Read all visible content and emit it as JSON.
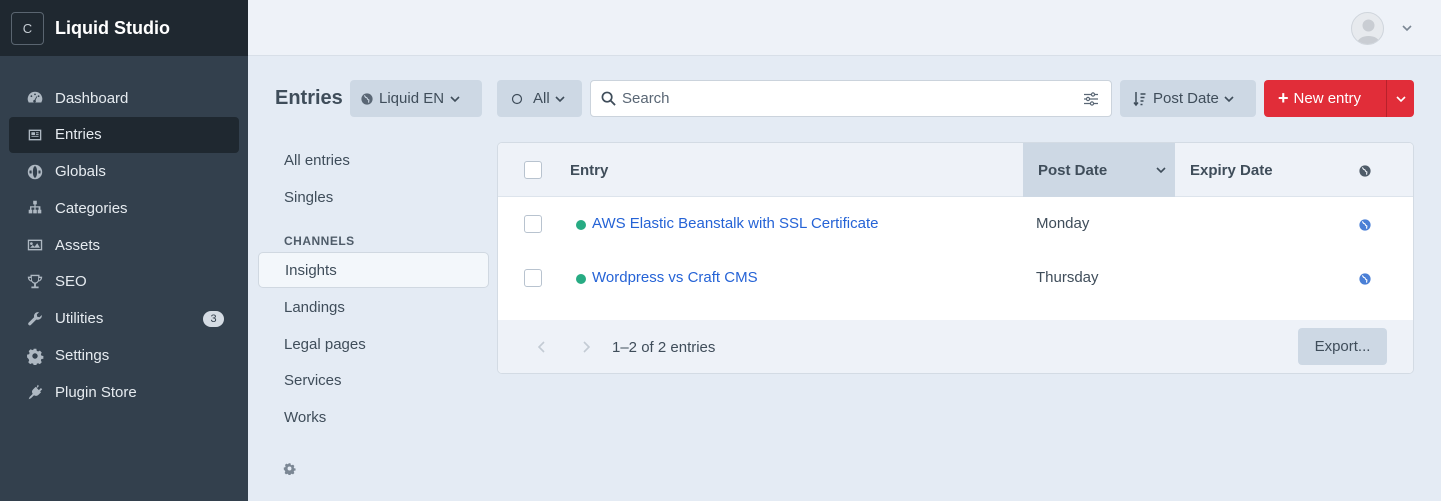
{
  "app": {
    "logo_letter": "C",
    "name": "Liquid Studio"
  },
  "sidebar": {
    "items": [
      {
        "label": "Dashboard",
        "icon": "gauge-icon"
      },
      {
        "label": "Entries",
        "icon": "newspaper-icon",
        "active": true
      },
      {
        "label": "Globals",
        "icon": "globe-icon"
      },
      {
        "label": "Categories",
        "icon": "sitemap-icon"
      },
      {
        "label": "Assets",
        "icon": "image-icon"
      },
      {
        "label": "SEO",
        "icon": "trophy-icon"
      },
      {
        "label": "Utilities",
        "icon": "wrench-icon",
        "badge": "3"
      },
      {
        "label": "Settings",
        "icon": "gear-icon"
      },
      {
        "label": "Plugin Store",
        "icon": "plug-icon"
      }
    ]
  },
  "header": {
    "user_avatar": "user-avatar-icon"
  },
  "toolbar": {
    "title": "Entries",
    "site_label": "Liquid EN",
    "status_label": "All",
    "search_placeholder": "Search",
    "sort_label": "Post Date",
    "new_entry_label": "New entry"
  },
  "sources": {
    "all_entries": "All entries",
    "singles": "Singles",
    "channels_heading": "CHANNELS",
    "channels": [
      "Insights",
      "Landings",
      "Legal pages",
      "Services",
      "Works"
    ],
    "active": "Insights"
  },
  "table": {
    "columns": {
      "entry": "Entry",
      "post_date": "Post Date",
      "expiry_date": "Expiry Date"
    },
    "rows": [
      {
        "title": "AWS Elastic Beanstalk with SSL Certificate",
        "post_date": "Monday",
        "expiry_date": "",
        "status": "live"
      },
      {
        "title": "Wordpress vs Craft CMS",
        "post_date": "Thursday",
        "expiry_date": "",
        "status": "live"
      }
    ],
    "footer": {
      "count_text": "1–2 of 2 entries",
      "export_label": "Export..."
    }
  },
  "colors": {
    "accent_red": "#e12d39",
    "link_blue": "#2563d6",
    "live_green": "#27ab83",
    "sidebar_bg": "#33404d"
  }
}
